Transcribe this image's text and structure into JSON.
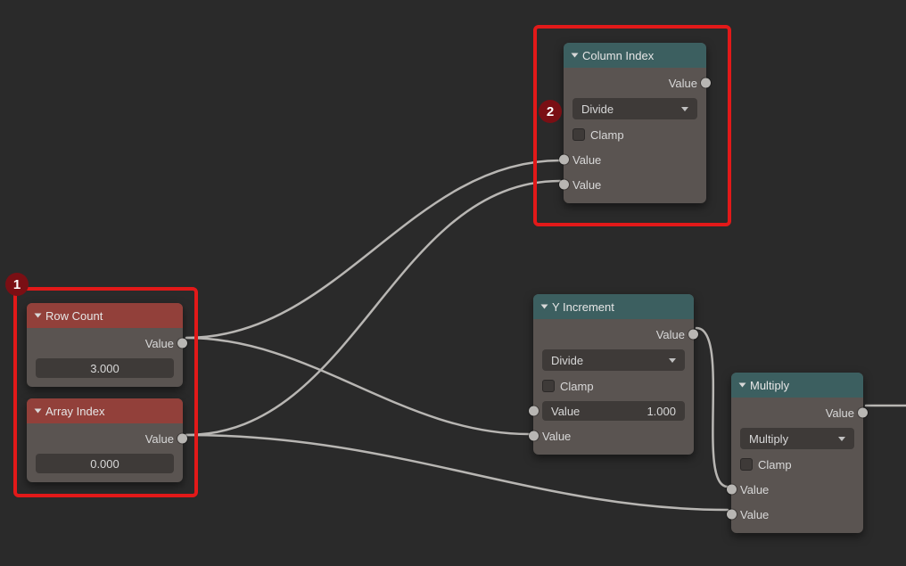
{
  "sockets": {
    "value": "Value"
  },
  "nodes": {
    "row_count": {
      "title": "Row Count",
      "value": "3.000"
    },
    "array_index": {
      "title": "Array Index",
      "value": "0.000"
    },
    "column_index": {
      "title": "Column Index",
      "op": "Divide",
      "clamp": "Clamp"
    },
    "y_increment": {
      "title": "Y Increment",
      "op": "Divide",
      "clamp": "Clamp",
      "input_val": "1.000"
    },
    "multiply": {
      "title": "Multiply",
      "op": "Multiply",
      "clamp": "Clamp"
    }
  },
  "annotations": {
    "a1": "1",
    "a2": "2"
  }
}
